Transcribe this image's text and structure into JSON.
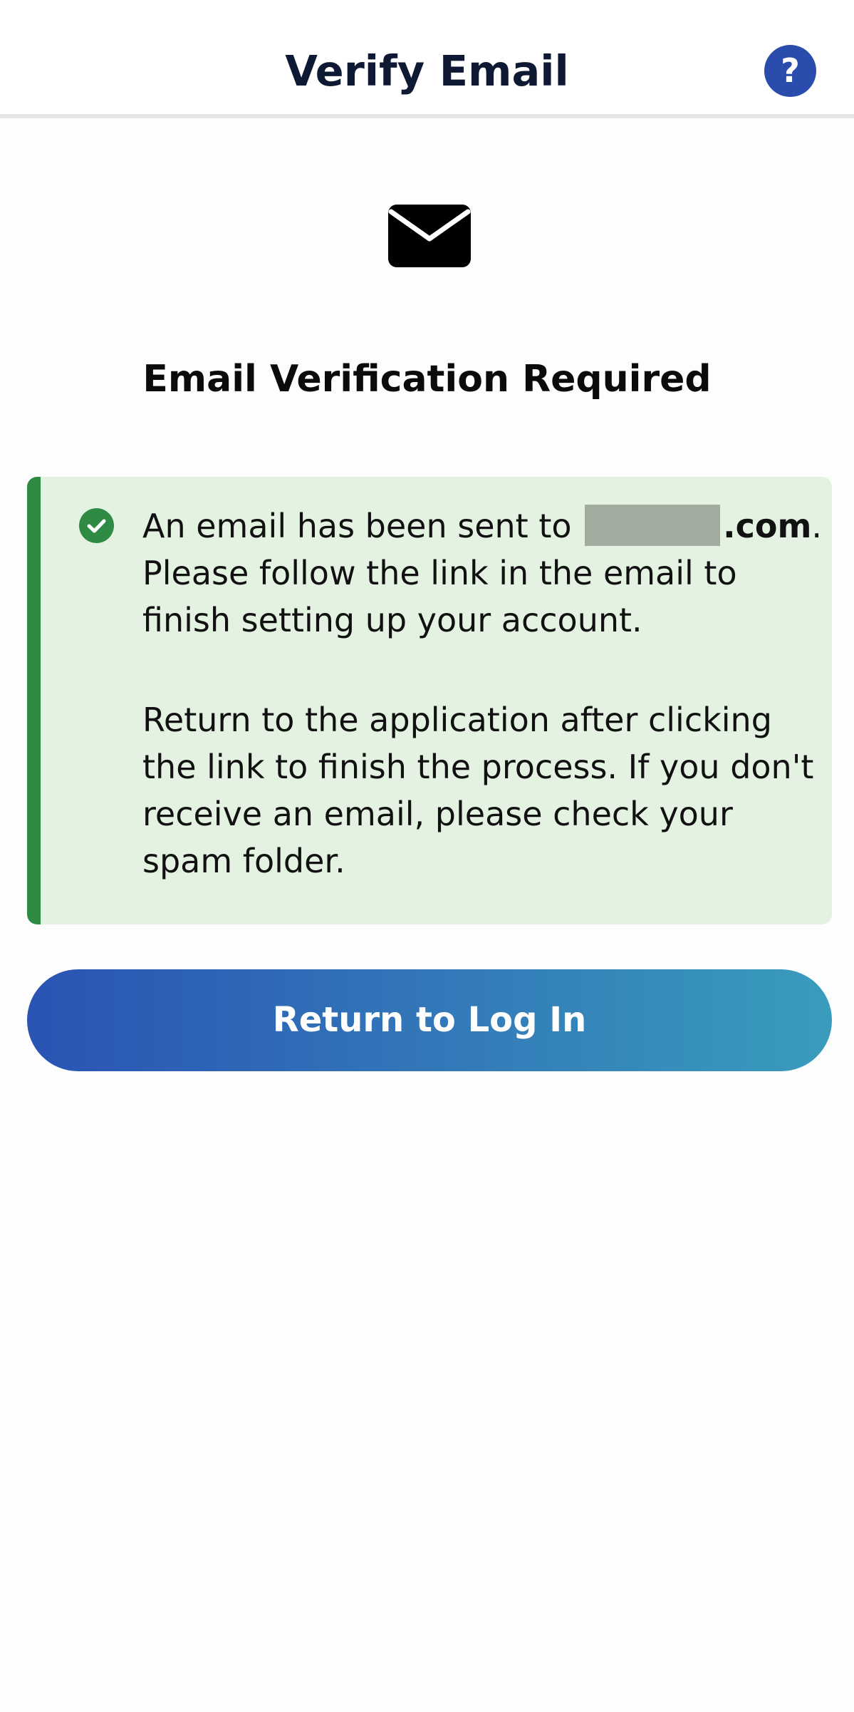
{
  "header": {
    "title": "Verify Email",
    "help_label": "?"
  },
  "main": {
    "icon": "envelope-icon",
    "heading": "Email Verification Required",
    "alert": {
      "icon": "check-circle-icon",
      "sent_prefix": "An email has been sent to",
      "email_domain": ".com",
      "sent_suffix": ".",
      "follow_text": "Please follow the link in the email to finish setting up your account.",
      "return_text": "Return to the application after clicking the link to finish the process. If you don't receive an email, please check your spam folder."
    },
    "return_button_label": "Return to Log In"
  },
  "colors": {
    "header_title": "#0e1a33",
    "help_button": "#2a4dad",
    "alert_background": "#e4f2e2",
    "alert_accent": "#2f8a44",
    "button_gradient_start": "#2a53b4",
    "button_gradient_end": "#3a9cbd"
  }
}
